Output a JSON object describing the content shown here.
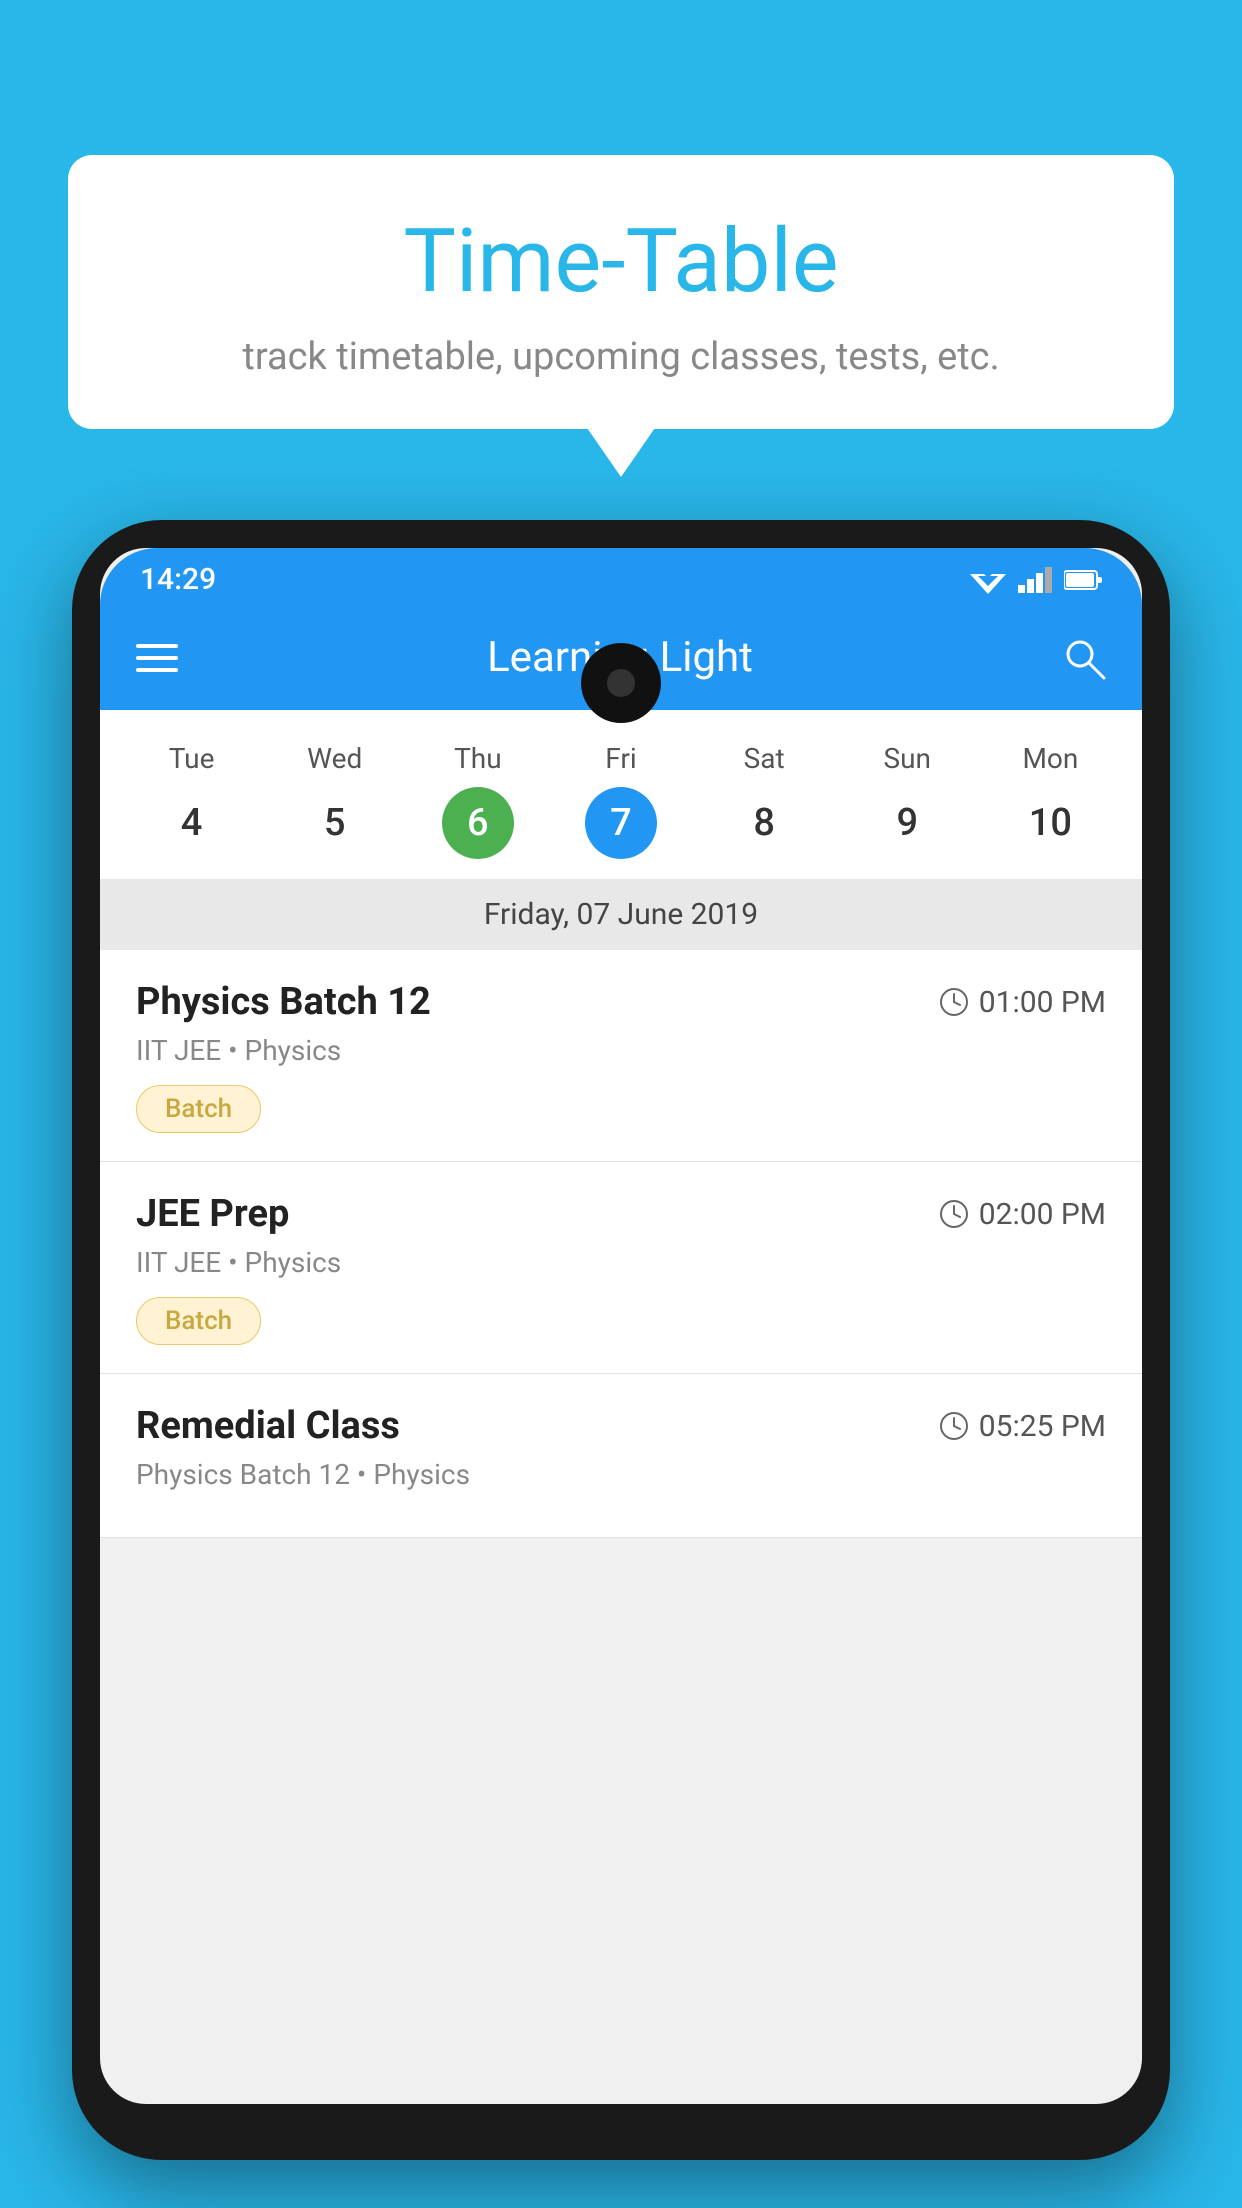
{
  "background_color": "#29b6e8",
  "speech_bubble": {
    "title": "Time-Table",
    "subtitle": "track timetable, upcoming classes, tests, etc."
  },
  "phone": {
    "status_bar": {
      "time": "14:29"
    },
    "app_bar": {
      "title": "Learning Light",
      "menu_icon_label": "hamburger-menu",
      "search_icon_label": "search"
    },
    "calendar": {
      "days": [
        "Tue",
        "Wed",
        "Thu",
        "Fri",
        "Sat",
        "Sun",
        "Mon"
      ],
      "dates": [
        "4",
        "5",
        "6",
        "7",
        "8",
        "9",
        "10"
      ],
      "today_index": 2,
      "selected_index": 3,
      "selected_label": "Friday, 07 June 2019"
    },
    "schedule": [
      {
        "title": "Physics Batch 12",
        "time": "01:00 PM",
        "subtitle": "IIT JEE • Physics",
        "badge": "Batch"
      },
      {
        "title": "JEE Prep",
        "time": "02:00 PM",
        "subtitle": "IIT JEE • Physics",
        "badge": "Batch"
      },
      {
        "title": "Remedial Class",
        "time": "05:25 PM",
        "subtitle": "Physics Batch 12 • Physics",
        "badge": ""
      }
    ]
  }
}
